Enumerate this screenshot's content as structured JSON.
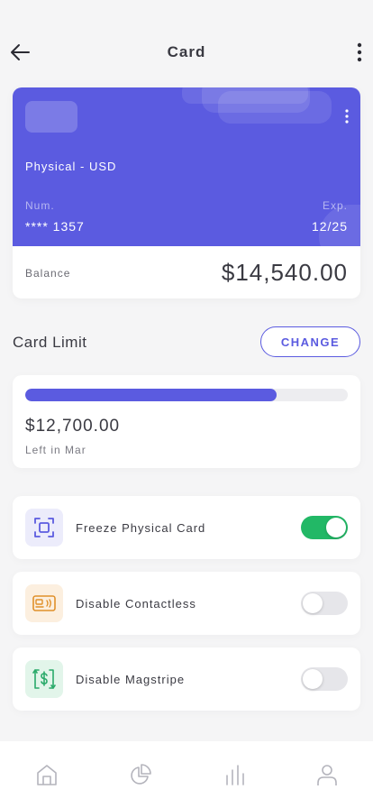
{
  "header": {
    "title": "Card"
  },
  "card": {
    "type_label": "Physical - USD",
    "num_label": "Num.",
    "num_value": "**** 1357",
    "exp_label": "Exp.",
    "exp_value": "12/25",
    "balance_label": "Balance",
    "balance_value": "$14,540.00",
    "color": "#5b5be0"
  },
  "limit": {
    "title": "Card Limit",
    "change_label": "CHANGE",
    "amount": "$12,700.00",
    "subtitle": "Left in Mar",
    "progress_fraction": 0.78
  },
  "settings": [
    {
      "label": "Freeze Physical Card",
      "icon": "freeze-icon",
      "enabled": true,
      "icon_color": "#5b5be0",
      "icon_bg": "#ececfb"
    },
    {
      "label": "Disable Contactless",
      "icon": "contactless-card-icon",
      "enabled": false,
      "icon_color": "#e0902a",
      "icon_bg": "#fcefdf"
    },
    {
      "label": "Disable Magstripe",
      "icon": "magstripe-dollar-icon",
      "enabled": false,
      "icon_color": "#2aaa6a",
      "icon_bg": "#e2f5ea"
    }
  ],
  "nav": {
    "items": [
      {
        "icon": "home-icon"
      },
      {
        "icon": "pie-chart-icon"
      },
      {
        "icon": "bar-chart-icon"
      },
      {
        "icon": "profile-icon"
      }
    ]
  },
  "colors": {
    "accent": "#5b5be0",
    "toggle_on": "#22b866",
    "toggle_off": "#e6e6ea"
  }
}
